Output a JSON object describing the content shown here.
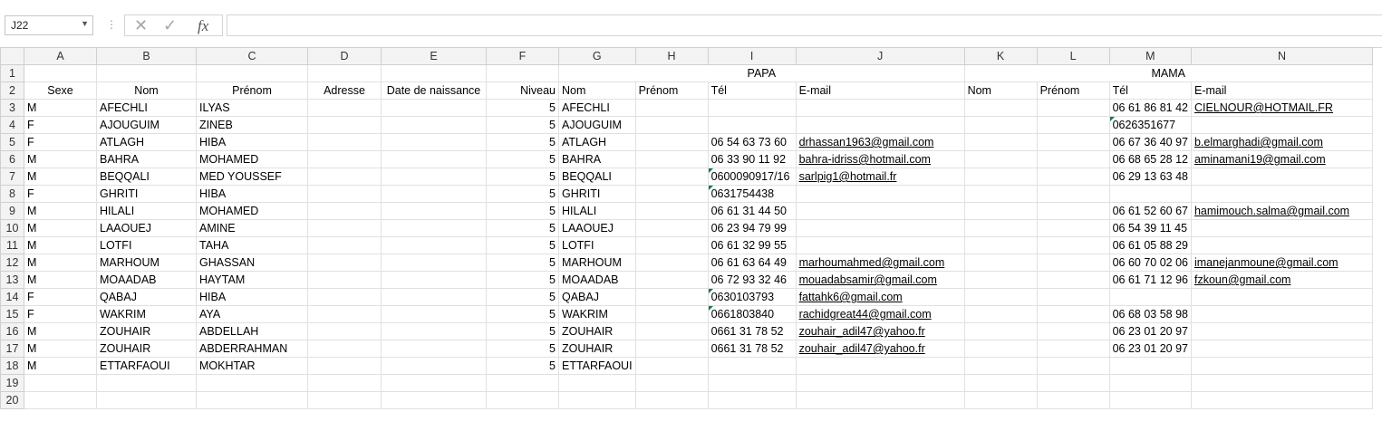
{
  "formula_bar": {
    "name_box": "J22",
    "cancel_glyph": "✕",
    "enter_glyph": "✓",
    "fx_label": "fx",
    "formula_value": ""
  },
  "columns": [
    "A",
    "B",
    "C",
    "D",
    "E",
    "F",
    "G",
    "H",
    "I",
    "J",
    "K",
    "L",
    "M",
    "N"
  ],
  "rows": [
    [
      "",
      "",
      "",
      "",
      "",
      "",
      "",
      "",
      "",
      "PAPA",
      "",
      "",
      "",
      "MAMA",
      ""
    ],
    [
      "",
      "Sexe",
      "Nom",
      "Prénom",
      "Adresse",
      "Date de naissance",
      "Niveau",
      "Nom",
      "Prénom",
      "Tél",
      "E-mail",
      "Nom",
      "Prénom",
      "Tél",
      "E-mail"
    ],
    [
      "M",
      "AFECHLI",
      "ILYAS",
      "",
      "",
      "5",
      "AFECHLI",
      "",
      "",
      "",
      "",
      "",
      "06 61 86 81 42",
      "CIELNOUR@HOTMAIL.FR"
    ],
    [
      "F",
      "AJOUGUIM",
      "ZINEB",
      "",
      "",
      "5",
      "AJOUGUIM",
      "",
      "",
      "",
      "",
      "",
      "0626351677",
      ""
    ],
    [
      "F",
      "ATLAGH",
      "HIBA",
      "",
      "",
      "5",
      "ATLAGH",
      "",
      "06 54 63 73 60",
      "drhassan1963@gmail.com",
      "",
      "",
      "06 67 36 40 97",
      "b.elmarghadi@gmail.com"
    ],
    [
      "M",
      "BAHRA",
      "MOHAMED",
      "",
      "",
      "5",
      "BAHRA",
      "",
      "06 33 90 11 92",
      "bahra-idriss@hotmail.com",
      "",
      "",
      "06 68 65 28 12",
      "aminamani19@gmail.com"
    ],
    [
      "M",
      "BEQQALI",
      "MED YOUSSEF",
      "",
      "",
      "5",
      "BEQQALI",
      "",
      "0600090917/16",
      "sarlpig1@hotmail.fr",
      "",
      "",
      "06 29 13 63 48",
      ""
    ],
    [
      "F",
      "GHRITI",
      "HIBA",
      "",
      "",
      "5",
      "GHRITI",
      "",
      "0631754438",
      "",
      "",
      "",
      "",
      ""
    ],
    [
      "M",
      "HILALI",
      "MOHAMED",
      "",
      "",
      "5",
      "HILALI",
      "",
      "06 61 31 44 50",
      "",
      "",
      "",
      "06 61 52 60 67",
      "hamimouch.salma@gmail.com"
    ],
    [
      "M",
      "LAAOUEJ",
      "AMINE",
      "",
      "",
      "5",
      "LAAOUEJ",
      "",
      "06 23 94 79 99",
      "",
      "",
      "",
      "06 54 39 11 45",
      ""
    ],
    [
      "M",
      "LOTFI",
      "TAHA",
      "",
      "",
      "5",
      "LOTFI",
      "",
      "06 61 32 99 55",
      "",
      "",
      "",
      "06 61 05 88 29",
      ""
    ],
    [
      "M",
      "MARHOUM",
      "GHASSAN",
      "",
      "",
      "5",
      "MARHOUM",
      "",
      "06 61 63 64 49",
      "marhoumahmed@gmail.com",
      "",
      "",
      "06 60 70 02 06",
      "imanejanmoune@gmail.com"
    ],
    [
      "M",
      "MOAADAB",
      "HAYTAM",
      "",
      "",
      "5",
      "MOAADAB",
      "",
      "06 72 93 32 46",
      "mouadabsamir@gmail.com",
      "",
      "",
      "06 61 71 12 96",
      "fzkoun@gmail.com"
    ],
    [
      "F",
      "QABAJ",
      " HIBA",
      "",
      "",
      "5",
      "QABAJ",
      "",
      "0630103793",
      "fattahk6@gmail.com",
      "",
      "",
      "",
      ""
    ],
    [
      "F",
      "WAKRIM",
      "AYA",
      "",
      "",
      "5",
      "WAKRIM",
      "",
      "0661803840",
      "rachidgreat44@gmail.com",
      "",
      "",
      "06 68 03 58 98",
      ""
    ],
    [
      "M",
      "ZOUHAIR",
      "ABDELLAH",
      "",
      "",
      "5",
      "ZOUHAIR",
      "",
      "0661 31 78 52",
      "zouhair_adil47@yahoo.fr",
      "",
      "",
      "06 23 01 20 97",
      ""
    ],
    [
      "M",
      "ZOUHAIR",
      "ABDERRAHMAN",
      "",
      "",
      "5",
      "ZOUHAIR",
      "",
      "0661 31 78 52",
      "zouhair_adil47@yahoo.fr",
      "",
      "",
      "06 23 01 20 97",
      ""
    ],
    [
      "M",
      "ETTARFAOUI",
      "MOKHTAR",
      "",
      "",
      "5",
      "ETTARFAOUI",
      "",
      "",
      "",
      "",
      "",
      "",
      ""
    ],
    [
      "",
      "",
      "",
      "",
      "",
      "",
      "",
      "",
      "",
      "",
      "",
      "",
      "",
      ""
    ],
    [
      "",
      "",
      "",
      "",
      "",
      "",
      "",
      "",
      "",
      "",
      "",
      "",
      "",
      ""
    ]
  ],
  "colors": {
    "link": "#0563c1",
    "header_bg": "#f3f3f3",
    "grid": "#e1e1e1",
    "error_triangle": "#107c41"
  }
}
